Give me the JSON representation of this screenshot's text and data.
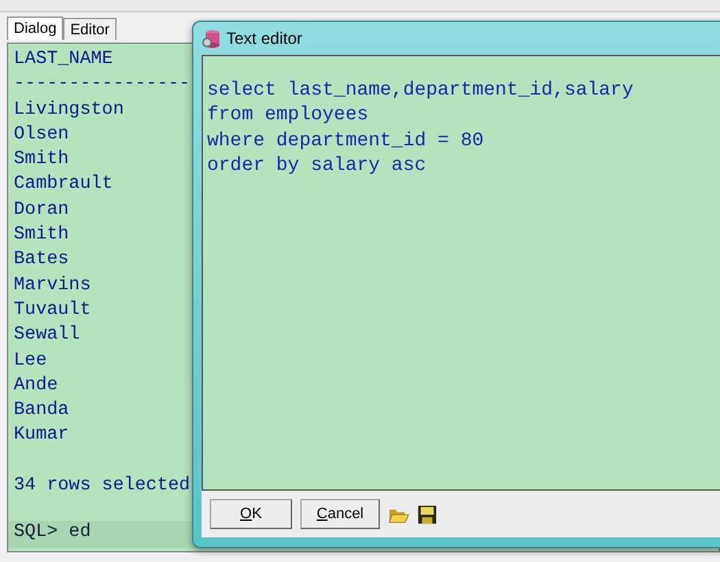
{
  "tabs": [
    {
      "label": "Dialog",
      "selected": true
    },
    {
      "label": "Editor",
      "selected": false
    }
  ],
  "console": {
    "lines": [
      "LAST_NAME",
      "----------------",
      "Livingston",
      "Olsen",
      "Smith",
      "Cambrault",
      "Doran",
      "Smith",
      "Bates",
      "Marvins",
      "Tuvault",
      "Sewall",
      "Lee",
      "Ande",
      "Banda",
      "Kumar"
    ],
    "summary": "34 rows selected",
    "prompt": "SQL> ed"
  },
  "dialog": {
    "title": "Text editor",
    "lines": [
      "select last_name,department_id,salary",
      "from employees",
      "where department_id = 80",
      "order by salary asc"
    ],
    "buttons": [
      "OK",
      "Cancel"
    ]
  }
}
